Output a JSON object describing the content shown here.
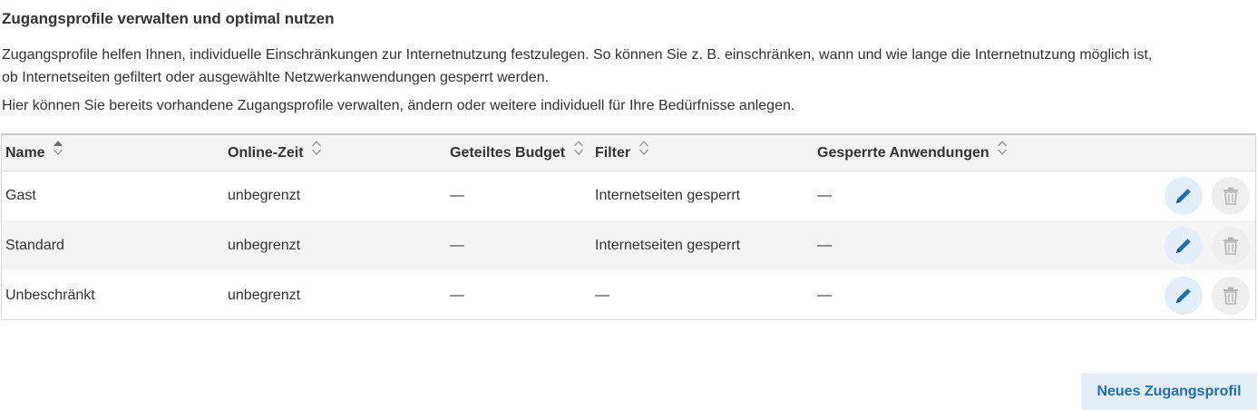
{
  "page": {
    "title": "Zugangsprofile verwalten und optimal nutzen",
    "intro_line1": "Zugangsprofile helfen Ihnen, individuelle Einschränkungen zur Internetnutzung festzulegen. So können Sie z. B. einschränken, wann und wie lange die Internetnutzung möglich ist,",
    "intro_line2": "ob Internetseiten gefiltert oder ausgewählte Netzwerkanwendungen gesperrt werden.",
    "intro_line3": "Hier können Sie bereits vorhandene Zugangsprofile verwalten, ändern oder weitere individuell für Ihre Bedürfnisse anlegen."
  },
  "table": {
    "columns": [
      "Name",
      "Online-Zeit",
      "Geteiltes Budget",
      "Filter",
      "Gesperrte Anwendungen"
    ],
    "rows": [
      [
        "Gast",
        "unbegrenzt",
        "—",
        "Internetseiten gesperrt",
        "—"
      ],
      [
        "Standard",
        "unbegrenzt",
        "—",
        "Internetseiten gesperrt",
        "—"
      ],
      [
        "Unbeschränkt",
        "unbegrenzt",
        "—",
        "—",
        "—"
      ]
    ],
    "icons": {
      "edit": "pencil-icon",
      "delete": "trash-icon",
      "sort": "sort-icon"
    },
    "colors": {
      "accent": "#1f6fb6",
      "edit_bg": "#e3eff8",
      "row_alt": "#f4f4f4",
      "disabled": "#b5b5b5"
    }
  },
  "actions": {
    "new_profile": "Neues Zugangsprofil"
  }
}
